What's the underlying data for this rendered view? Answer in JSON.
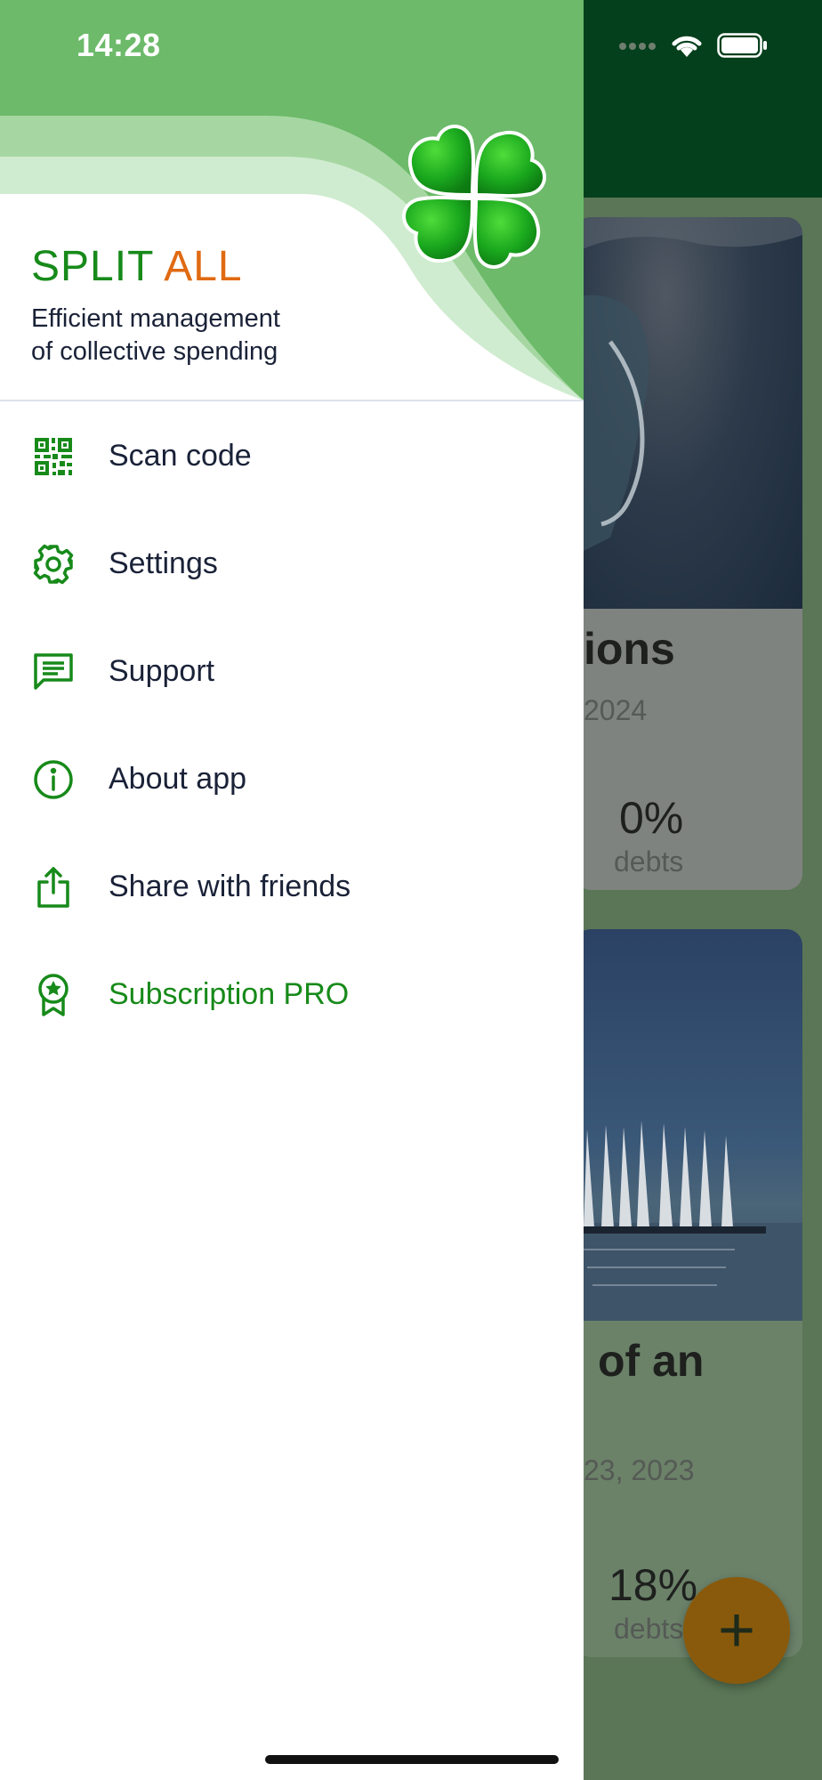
{
  "status_bar": {
    "time": "14:28",
    "icons": [
      "signal-icon",
      "wifi-icon",
      "battery-icon"
    ]
  },
  "drawer": {
    "brand_part1": "SPLIT",
    "brand_part2": "ALL",
    "tagline_line1": "Efficient management",
    "tagline_line2": "of collective spending",
    "menu": [
      {
        "label": "Scan code",
        "icon": "qr-code-icon"
      },
      {
        "label": "Settings",
        "icon": "gear-icon"
      },
      {
        "label": "Support",
        "icon": "chat-icon"
      },
      {
        "label": "About app",
        "icon": "info-icon"
      },
      {
        "label": "Share with friends",
        "icon": "share-icon"
      },
      {
        "label": "Subscription PRO",
        "icon": "badge-icon"
      }
    ]
  },
  "background": {
    "cards": [
      {
        "title": "ions",
        "date": "2024",
        "percent": "0%",
        "percent_label": "debts"
      },
      {
        "title": "of an",
        "date": "23, 2023",
        "percent": "18%",
        "percent_label": "debts"
      }
    ],
    "fab_label": "+"
  },
  "colors": {
    "brand_green": "#178a1a",
    "brand_orange": "#e06a12",
    "header_green": "#6cba6a",
    "text_dark": "#1a2238"
  }
}
